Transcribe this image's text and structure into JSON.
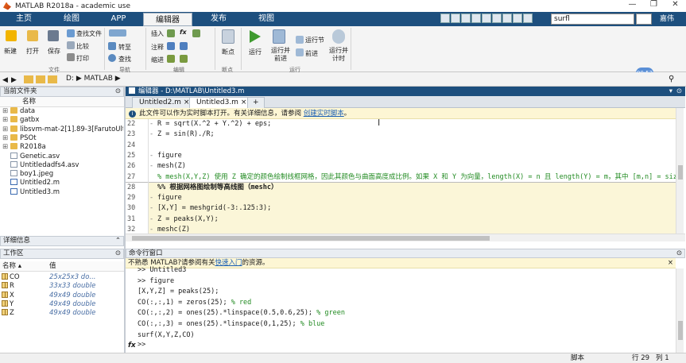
{
  "window": {
    "title": "MATLAB R2018a - academic use",
    "controls": [
      "—",
      "❐",
      "✕"
    ]
  },
  "tabs": [
    {
      "label": "主页"
    },
    {
      "label": "绘图"
    },
    {
      "label": "APP"
    },
    {
      "label": "编辑器"
    },
    {
      "label": "发布"
    },
    {
      "label": "视图"
    }
  ],
  "search": {
    "value": "surfl"
  },
  "signin": "嘉伟",
  "ribbon": {
    "file": {
      "new": "新建",
      "open": "打开",
      "save": "保存",
      "find_files": "查找文件",
      "compare": "比较",
      "print": "打印",
      "group": "文件"
    },
    "nav": {
      "goto": "转至",
      "find": "查找",
      "group": "导航"
    },
    "edit": {
      "insert": "插入",
      "comment": "注释",
      "indent": "缩进",
      "fx": "fx",
      "group": "编辑"
    },
    "breakpoints": {
      "label": "断点",
      "group": "断点"
    },
    "run": {
      "run": "运行",
      "run_advance": "运行并\n前进",
      "run_section": "运行节",
      "advance": "前进",
      "run_time": "运行并\n计时",
      "group": "运行"
    }
  },
  "path": {
    "drive": "D:",
    "folder": "MATLAB"
  },
  "clock": "00:52",
  "current_folder": {
    "header": "当前文件夹",
    "col_name": "名称",
    "items": [
      {
        "name": "data",
        "type": "folder"
      },
      {
        "name": "gatbx",
        "type": "folder"
      },
      {
        "name": "libsvm-mat-2[1].89-3[FarutoUlti...",
        "type": "folder"
      },
      {
        "name": "PSOt",
        "type": "folder"
      },
      {
        "name": "R2018a",
        "type": "folder"
      },
      {
        "name": "Genetic.asv",
        "type": "file"
      },
      {
        "name": "Untitledadfs4.asv",
        "type": "file"
      },
      {
        "name": "boy1.jpeg",
        "type": "file"
      },
      {
        "name": "Untitled2.m",
        "type": "mfile"
      },
      {
        "name": "Untitled3.m",
        "type": "mfile"
      }
    ]
  },
  "details": {
    "header": "详细信息"
  },
  "workspace": {
    "header": "工作区",
    "col_name": "名称 ▴",
    "col_value": "值",
    "vars": [
      {
        "name": "CO",
        "value": "25x25x3 do..."
      },
      {
        "name": "R",
        "value": "33x33 double"
      },
      {
        "name": "X",
        "value": "49x49 double"
      },
      {
        "name": "Y",
        "value": "49x49 double"
      },
      {
        "name": "Z",
        "value": "49x49 double"
      }
    ]
  },
  "editor": {
    "header": "编辑器 - D:\\MATLAB\\Untitled3.m",
    "tabs": [
      {
        "label": "Untitled2.m"
      },
      {
        "label": "Untitled3.m"
      }
    ],
    "add_tab": "+",
    "notice": "此文件可以作为实时脚本打开。有关详细信息，请参阅",
    "notice_link": "创建实时脚本",
    "notice_end": "。",
    "lines": [
      {
        "n": "22",
        "code": "R = sqrt(X.^2 + Y.^2) + eps;",
        "kind": "plain"
      },
      {
        "n": "23",
        "code": "Z = sin(R)./R;",
        "kind": "plain"
      },
      {
        "n": "24",
        "code": "",
        "kind": "plain"
      },
      {
        "n": "25",
        "code": "figure",
        "kind": "plain"
      },
      {
        "n": "26",
        "code": "mesh(Z)",
        "kind": "plain"
      },
      {
        "n": "27",
        "code": "% mesh(X,Y,Z) 使用 Z 确定的颜色绘制线框网格，因此其颜色与曲面高度成比例。如果 X 和 Y 为向量，length(X) = n 且 length(Y) = m，其中 [m,n] = size(Z)",
        "kind": "comment"
      },
      {
        "n": "28",
        "code": "%% 根据网格图绘制等高线图（meshc）",
        "kind": "cell"
      },
      {
        "n": "29",
        "code": "figure",
        "kind": "plain"
      },
      {
        "n": "30",
        "code": "[X,Y] = meshgrid(-3:.125:3);",
        "kind": "plain"
      },
      {
        "n": "31",
        "code": "Z = peaks(X,Y);",
        "kind": "plain"
      },
      {
        "n": "32",
        "code": "meshc(Z)",
        "kind": "plain"
      }
    ]
  },
  "command": {
    "header": "命令行窗口",
    "notice": "不熟悉 MATLAB?请参阅有关",
    "notice_link": "快速入门",
    "notice_end": "的资源。",
    "lines": [
      {
        "code": ">> Untitled3",
        "comment": ""
      },
      {
        "code": ">> figure",
        "comment": ""
      },
      {
        "code": "[X,Y,Z] = peaks(25);",
        "comment": ""
      },
      {
        "code": "CO(:,:,1) = zeros(25); ",
        "comment": "% red"
      },
      {
        "code": "CO(:,:,2) = ones(25).*linspace(0.5,0.6,25); ",
        "comment": "% green"
      },
      {
        "code": "CO(:,:,3) = ones(25).*linspace(0,1,25); ",
        "comment": "% blue"
      },
      {
        "code": "surf(X,Y,Z,CO)",
        "comment": ""
      }
    ],
    "prompt": ">>",
    "fx": "fx"
  },
  "status": {
    "mode": "脚本",
    "row_label": "行",
    "row": "29",
    "col_label": "列",
    "col": "1"
  },
  "colors": {
    "accent": "#1d4f7e",
    "notice_bg": "#fdf6d4",
    "comment": "#228b22",
    "link": "#1a5fb4"
  }
}
